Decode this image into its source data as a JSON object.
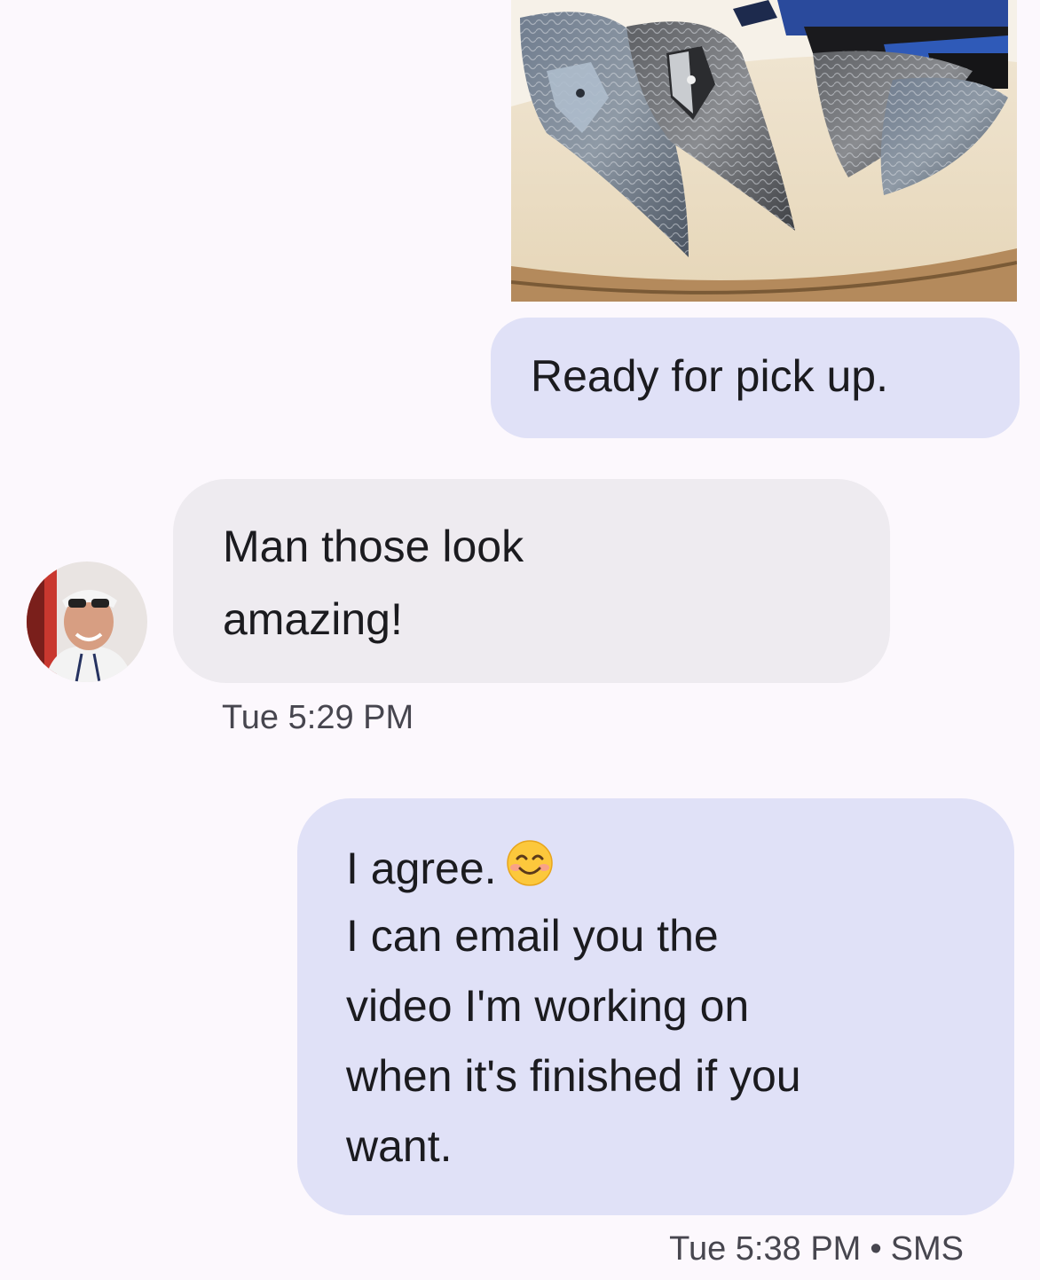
{
  "conversation": {
    "messages": [
      {
        "direction": "outgoing",
        "type": "image",
        "alt": "Damascus steel knives with castle-keyhole engraving on a wood slab"
      },
      {
        "direction": "outgoing",
        "type": "text",
        "lines": [
          "Ready for pick up."
        ]
      },
      {
        "direction": "incoming",
        "type": "text",
        "lines": [
          "Man those look",
          "amazing!"
        ],
        "timestamp": "Tue 5:29 PM"
      },
      {
        "direction": "outgoing",
        "type": "text",
        "lines": [
          "I agree.",
          "I can email you the",
          "video I'm working on",
          "when it's finished if you",
          "want."
        ],
        "emoji": "smiling-face-emoji",
        "timestamp": "Tue 5:38 PM",
        "separator": "•",
        "channel": "SMS"
      }
    ]
  },
  "colors": {
    "background": "#fcf8fd",
    "outgoing_bubble": "#e0e1f7",
    "incoming_bubble": "#eeebf0",
    "text": "#1b1b1f",
    "meta_text": "#47464f"
  }
}
